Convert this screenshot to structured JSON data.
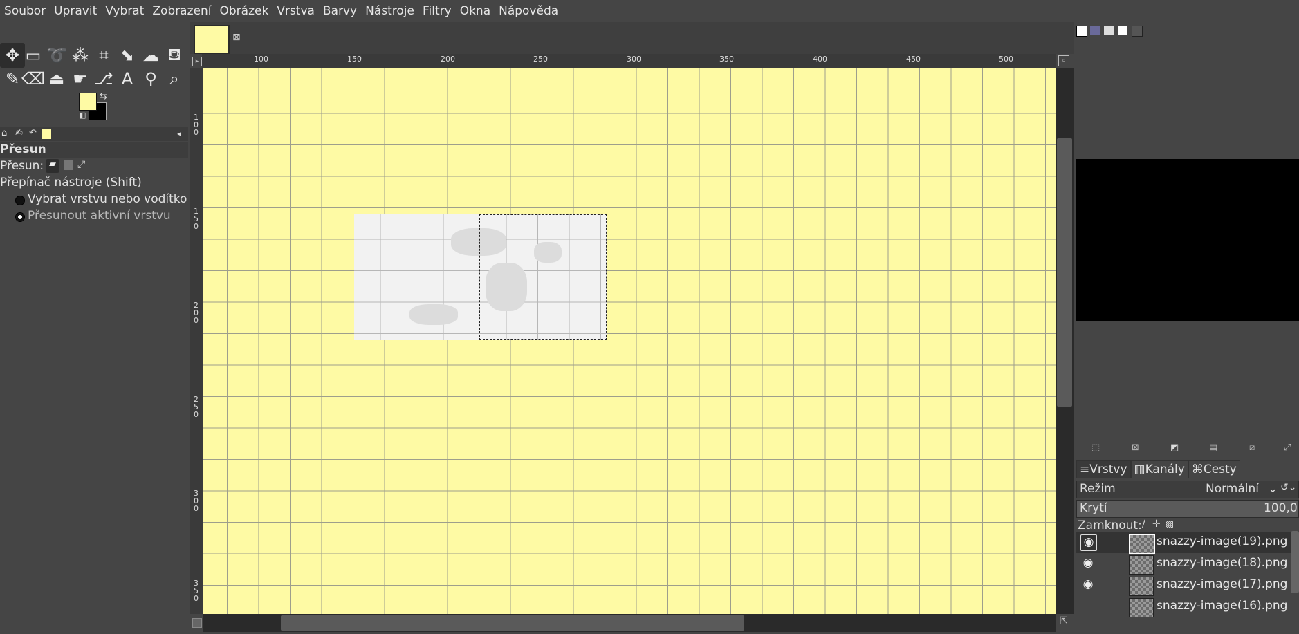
{
  "menubar": [
    "Soubor",
    "Upravit",
    "Vybrat",
    "Zobrazení",
    "Obrázek",
    "Vrstva",
    "Barvy",
    "Nástroje",
    "Filtry",
    "Okna",
    "Nápověda"
  ],
  "tool_options": {
    "title": "Přesun",
    "move_label": "Přesun:",
    "switch_label": "Přepínač nástroje  (Shift)",
    "radio_1": "Vybrat vrstvu nebo vodítko",
    "radio_2": "Přesunout aktivní vrstvu"
  },
  "colors": {
    "foreground": "#fefaa4",
    "background": "#000000",
    "canvas": "#fefaa4"
  },
  "ruler": {
    "horizontal": [
      "100",
      "150",
      "200",
      "250",
      "300",
      "350",
      "400",
      "450",
      "500"
    ],
    "vertical": [
      "100",
      "150",
      "200",
      "250",
      "300",
      "350"
    ]
  },
  "layers_panel": {
    "tabs": [
      "Vrstvy",
      "Kanály",
      "Cesty"
    ],
    "mode_label": "Režim",
    "mode_value": "Normální",
    "opacity_label": "Krytí",
    "opacity_value": "100,0",
    "lock_label": "Zamknout:",
    "layers": [
      {
        "name": "snazzy-image(19).png",
        "visible": true,
        "selected": true
      },
      {
        "name": "snazzy-image(18).png",
        "visible": true,
        "selected": false
      },
      {
        "name": "snazzy-image(17).png",
        "visible": true,
        "selected": false
      },
      {
        "name": "snazzy-image(16).png",
        "visible": false,
        "selected": false
      }
    ]
  },
  "icons": {
    "move": "move-icon",
    "rect_select": "rect-select-icon",
    "lasso": "lasso-icon",
    "fuzzy_select": "fuzzy-select-icon",
    "crop": "crop-icon",
    "transform": "transform-icon",
    "warp": "warp-icon",
    "bucket": "bucket-fill-icon",
    "paintbrush": "paintbrush-icon",
    "eraser": "eraser-icon",
    "clone": "clone-icon",
    "smudge": "smudge-icon",
    "paths": "paths-icon",
    "text": "text-icon",
    "color_picker": "color-picker-icon",
    "zoom": "zoom-icon",
    "eye": "eye-icon"
  }
}
